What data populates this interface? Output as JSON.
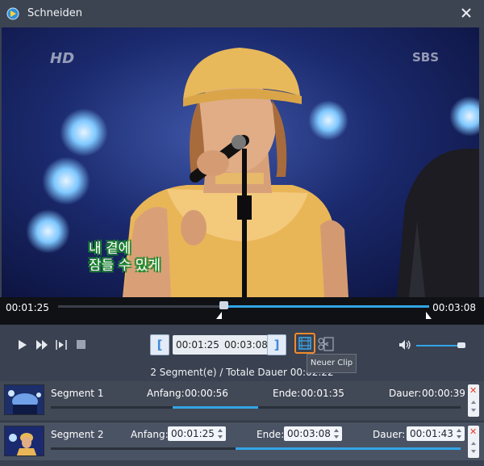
{
  "window": {
    "title": "Schneiden"
  },
  "video": {
    "logo_left": "HD",
    "logo_right": "SBS",
    "subtitle_line1": "내 곁에",
    "subtitle_line2": "잠들 수 있게"
  },
  "timeline": {
    "current_time": "00:01:25",
    "total_time": "00:03:08",
    "selection_start_fraction": 0.44,
    "selection_end_fraction": 1.0
  },
  "controls": {
    "start_time": "00:01:25",
    "end_time": "00:03:08",
    "new_clip_tooltip": "Neuer Clip",
    "volume_fraction": 0.85
  },
  "summary": "2 Segment(e) / Totale Dauer 00:02:22",
  "segments": [
    {
      "name": "Segment 1",
      "start_label": "Anfang:",
      "start": "00:00:56",
      "end_label": "Ende:",
      "end": "00:01:35",
      "duration_label": "Dauer:",
      "duration": "00:00:39",
      "fill_start": 0.298,
      "fill_end": 0.505
    },
    {
      "name": "Segment 2",
      "start_label": "Anfang:",
      "start": "00:01:25",
      "end_label": "Ende:",
      "end": "00:03:08",
      "duration_label": "Dauer:",
      "duration": "00:01:43",
      "fill_start": 0.45,
      "fill_end": 1.0
    }
  ],
  "colors": {
    "accent": "#32a5e6",
    "highlight": "#f08a2c",
    "delete": "#e43b2a"
  }
}
